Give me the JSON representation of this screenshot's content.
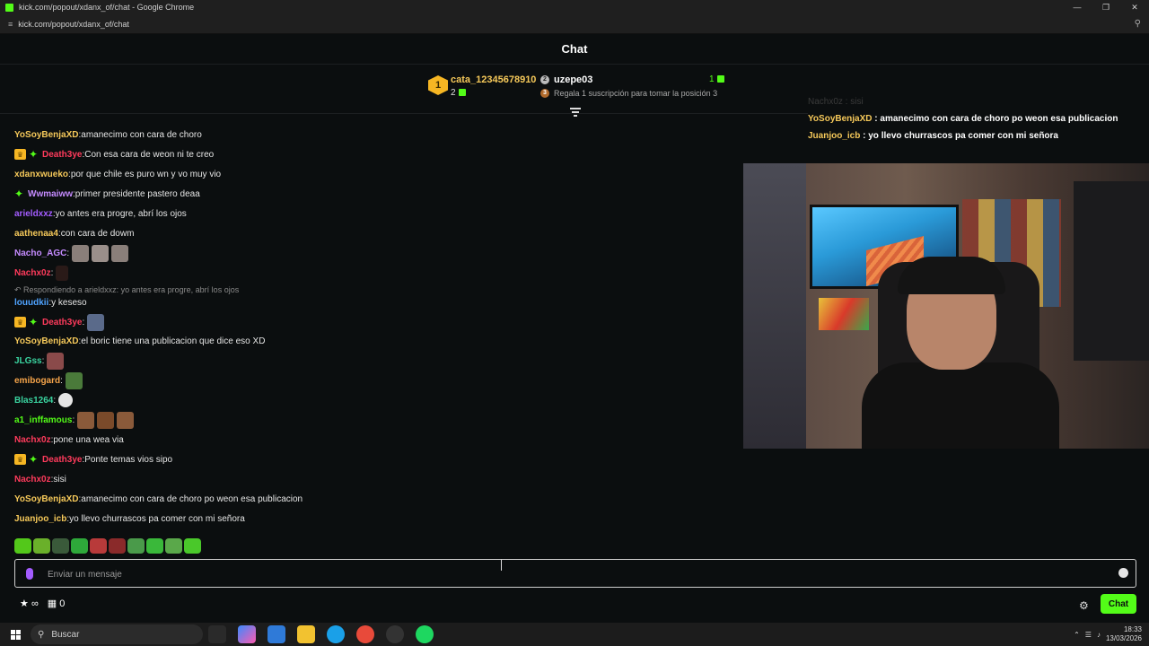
{
  "window": {
    "title": "kick.com/popout/xdanx_of/chat - Google Chrome",
    "url": "kick.com/popout/xdanx_of/chat"
  },
  "chat": {
    "title": "Chat"
  },
  "leaderboard": {
    "first": {
      "rank": "1",
      "name": "cata_12345678910",
      "count": "2"
    },
    "second": {
      "rank": "2",
      "name": "uzepe03",
      "count": "1"
    },
    "third": {
      "rank": "3",
      "hint": "Regala 1 suscripción para tomar la posición 3"
    }
  },
  "messages": [
    {
      "user": "YoSoyBenjaXD",
      "sep": ": ",
      "text": "amanecimo con cara de choro",
      "color": "#f6c95a",
      "badges": []
    },
    {
      "user": "Death3ye",
      "sep": ": ",
      "text": "Con esa cara de weon ni te creo",
      "color": "#ff3b5c",
      "badges": [
        "crown",
        "star"
      ]
    },
    {
      "user": "xdanxwueko",
      "sep": ": ",
      "text": "por que chile es puro wn y vo muy vio",
      "color": "#f6c95a",
      "badges": []
    },
    {
      "user": "Wwmaiww",
      "sep": ": ",
      "text": "primer presidente pastero deaa",
      "color": "#c58bff",
      "badges": [
        "star"
      ]
    },
    {
      "user": "arieldxxz",
      "sep": ": ",
      "text": "yo antes era progre, abrí los ojos",
      "color": "#a35cff",
      "badges": []
    },
    {
      "user": "aathenaa4",
      "sep": ": ",
      "text": "con cara de dowm",
      "color": "#f6c95a",
      "badges": []
    },
    {
      "user": "Nacho_AGC",
      "sep": ": ",
      "text": "",
      "color": "#c58bff",
      "badges": []
    },
    {
      "user": "Nachx0z",
      "sep": ": ",
      "text": "",
      "color": "#ff3b5c",
      "badges": []
    },
    {
      "user": "louudkii",
      "sep": ": ",
      "text": "y keseso",
      "color": "#4fa3ff",
      "badges": []
    },
    {
      "user": "Death3ye",
      "sep": ": ",
      "text": "",
      "color": "#ff3b5c",
      "badges": [
        "crown",
        "star"
      ]
    },
    {
      "user": "YoSoyBenjaXD",
      "sep": ": ",
      "text": "el boric tiene una publicacion que dice eso XD",
      "color": "#f6c95a",
      "badges": []
    },
    {
      "user": "JLGss",
      "sep": ": ",
      "text": "",
      "color": "#3ad4a0",
      "badges": []
    },
    {
      "user": "emibogard",
      "sep": ": ",
      "text": "",
      "color": "#f6a44a",
      "badges": []
    },
    {
      "user": "Blas1264",
      "sep": ": ",
      "text": "",
      "color": "#3ad4a0",
      "badges": []
    },
    {
      "user": "a1_inffamous",
      "sep": ": ",
      "text": "",
      "color": "#53fc18",
      "badges": []
    },
    {
      "user": "Nachx0z",
      "sep": ": ",
      "text": "pone una wea via",
      "color": "#ff3b5c",
      "badges": []
    },
    {
      "user": "Death3ye",
      "sep": ": ",
      "text": "Ponte temas vios sipo",
      "color": "#ff3b5c",
      "badges": [
        "crown",
        "star"
      ]
    },
    {
      "user": "Nachx0z",
      "sep": ": ",
      "text": "sisi",
      "color": "#ff3b5c",
      "badges": []
    },
    {
      "user": "YoSoyBenjaXD",
      "sep": ": ",
      "text": "amanecimo con cara de choro po weon esa publicacion",
      "color": "#f6c95a",
      "badges": []
    },
    {
      "user": "Juanjoo_icb",
      "sep": ": ",
      "text": "yo llevo churrascos pa comer con mi señora",
      "color": "#f6c95a",
      "badges": []
    }
  ],
  "reply": {
    "prefix": "Respondiendo a ",
    "target": "arieldxxz",
    "quoted": ": yo antes era progre, abrí los ojos"
  },
  "overlay": [
    {
      "user": "Nachx0z",
      "text": " : sisi"
    },
    {
      "user": "YoSoyBenjaXD",
      "text": " : amanecimo con cara de choro po weon esa publicacion"
    },
    {
      "user": "Juanjoo_icb",
      "text": " : yo llevo churrascos pa comer con mi señora"
    }
  ],
  "input": {
    "placeholder": "Enviar un mensaje"
  },
  "bottom": {
    "points": "∞",
    "count": "0",
    "chat_button": "Chat"
  },
  "taskbar": {
    "search": "Buscar",
    "time": "18:33",
    "date": "13/03/2026"
  },
  "colors": {
    "accent": "#53fc18",
    "background": "#0b0e0f"
  }
}
